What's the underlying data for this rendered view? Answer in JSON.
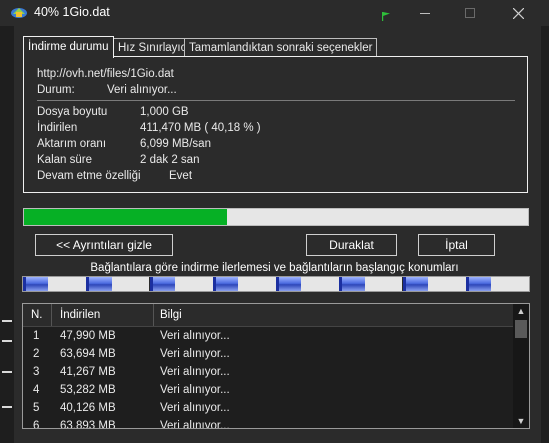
{
  "window": {
    "title": "40% 1Gio.dat"
  },
  "tabs": [
    "İndirme durumu",
    "Hız Sınırlayıcı",
    "Tamamlandıktan sonraki seçenekler"
  ],
  "status": {
    "url": "http://ovh.net/files/1Gio.dat",
    "state_label": "Durum:",
    "state_value": "Veri alınıyor...",
    "file_size_label": "Dosya boyutu",
    "file_size_value": "1,000  GB",
    "downloaded_label": "İndirilen",
    "downloaded_value": "411,470  MB  ( 40,18 % )",
    "rate_label": "Aktarım oranı",
    "rate_value": "6,099  MB/san",
    "remaining_label": "Kalan süre",
    "remaining_value": "2 dak 2 san",
    "resume_label": "Devam etme özelliği",
    "resume_value": "Evet"
  },
  "progress": {
    "fraction": 0.4018
  },
  "buttons": {
    "details": "<< Ayrıntıları gizle",
    "pause": "Duraklat",
    "cancel": "İptal"
  },
  "connections": {
    "caption": "Bağlantılara göre indirme ilerlemesi ve bağlantıların başlangıç konumları",
    "progress_fractions": [
      0.4,
      0.4,
      0.4,
      0.4,
      0.4,
      0.4,
      0.4,
      0.4
    ]
  },
  "table": {
    "columns": [
      "N.",
      "İndirilen",
      "Bilgi"
    ],
    "rows": [
      [
        "1",
        "47,990  MB",
        "Veri alınıyor..."
      ],
      [
        "2",
        "63,694  MB",
        "Veri alınıyor..."
      ],
      [
        "3",
        "41,267  MB",
        "Veri alınıyor..."
      ],
      [
        "4",
        "53,282  MB",
        "Veri alınıyor..."
      ],
      [
        "5",
        "40,126  MB",
        "Veri alınıyor..."
      ],
      [
        "6",
        "63,893  MB",
        "Veri alınıyor..."
      ]
    ]
  },
  "colors": {
    "progress_fill": "#06b025",
    "connection_blue": "#4d6ce0"
  }
}
